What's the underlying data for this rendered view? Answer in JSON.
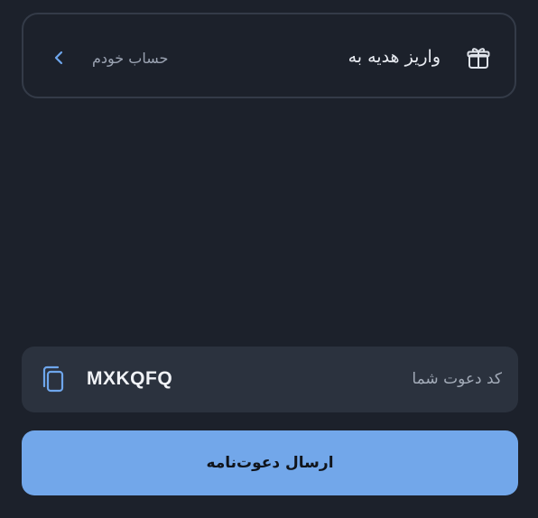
{
  "gift_deposit": {
    "title": "واریز هدیه به",
    "account_label": "حساب خودم"
  },
  "invite_code": {
    "label": "کد دعوت شما",
    "value": "MXKQFQ"
  },
  "send_button": {
    "label": "ارسال دعوت‌نامه"
  },
  "colors": {
    "background": "#1c212b",
    "card_border": "#343b48",
    "code_box": "#2b323e",
    "accent": "#72a7ea",
    "chevron": "#6ea6ec"
  },
  "icons": {
    "gift": "gift-icon",
    "chevron": "chevron-left-icon",
    "copy": "copy-icon"
  }
}
